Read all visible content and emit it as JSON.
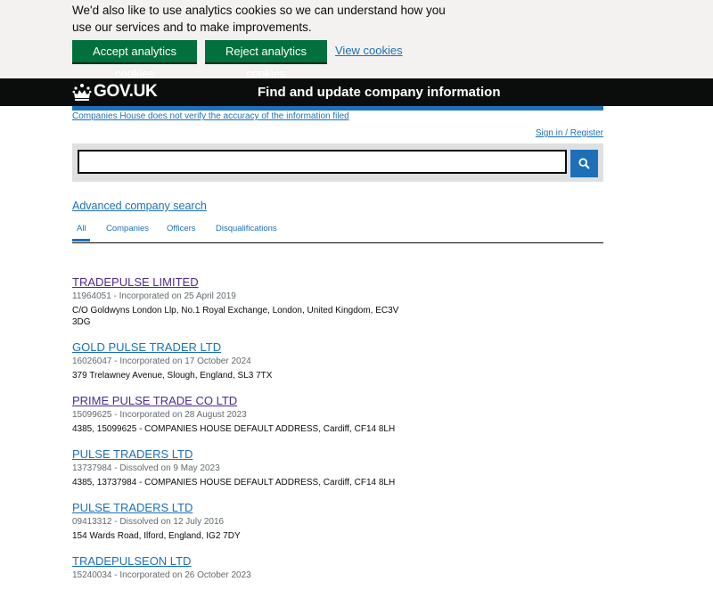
{
  "cookie_banner": {
    "text": "We'd also like to use analytics cookies so we can understand how you use our services and to make improvements.",
    "accept_label": "Accept analytics cookies",
    "reject_label": "Reject analytics cookies",
    "view_label": "View cookies"
  },
  "header": {
    "logo_text": "GOV.UK",
    "service_name": "Find and update company information"
  },
  "notice": {
    "verify_text": "Companies House does not verify the accuracy of the information filed",
    "signin_text": "Sign in / Register"
  },
  "search": {
    "value": "",
    "placeholder": ""
  },
  "advanced_search_label": "Advanced company search",
  "tabs": [
    {
      "label": "All"
    },
    {
      "label": "Companies"
    },
    {
      "label": "Officers"
    },
    {
      "label": "Disqualifications"
    }
  ],
  "results": [
    {
      "name": "TRADEPULSE LIMITED",
      "meta": "11964051 - Incorporated on 25 April 2019",
      "address": "C/O Goldwyns London Llp, No.1 Royal Exchange, London, United Kingdom, EC3V 3DG"
    },
    {
      "name": "GOLD PULSE TRADER LTD",
      "meta": "16026047 - Incorporated on 17 October 2024",
      "address": "379 Trelawney Avenue, Slough, England, SL3 7TX"
    },
    {
      "name": "PRIME PULSE TRADE CO LTD",
      "meta": "15099625 - Incorporated on 28 August 2023",
      "address": "4385, 15099625 - COMPANIES HOUSE DEFAULT ADDRESS, Cardiff, CF14 8LH"
    },
    {
      "name": "PULSE TRADERS LTD",
      "meta": "13737984 - Dissolved on 9 May 2023",
      "address": "4385, 13737984 - COMPANIES HOUSE DEFAULT ADDRESS, Cardiff, CF14 8LH"
    },
    {
      "name": "PULSE TRADERS LTD",
      "meta": "09413312 - Dissolved on 12 July 2016",
      "address": "154 Wards Road, Ilford, England, IG2 7DY"
    },
    {
      "name": "TRADEPULSEON LTD",
      "meta": "15240034 - Incorporated on 26 October 2023",
      "address": ""
    }
  ]
}
